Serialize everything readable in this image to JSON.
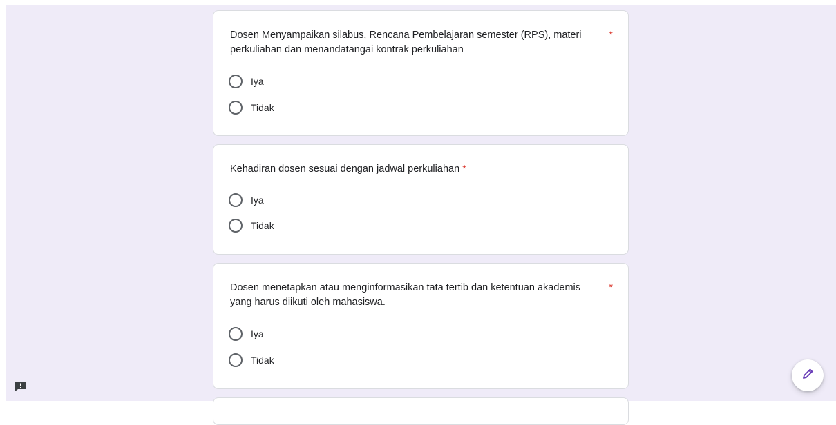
{
  "questions": [
    {
      "title": "Dosen Menyampaikan silabus, Rencana Pembelajaran semester (RPS), materi perkuliahan dan menandatangai kontrak perkuliahan",
      "required_mark": "*",
      "options": [
        "Iya",
        "Tidak"
      ]
    },
    {
      "title": "Kehadiran dosen sesuai dengan jadwal perkuliahan",
      "required_mark": "*",
      "options": [
        "Iya",
        "Tidak"
      ]
    },
    {
      "title": "Dosen menetapkan atau menginformasikan tata tertib dan ketentuan akademis yang harus diikuti oleh mahasiswa.",
      "required_mark": "*",
      "options": [
        "Iya",
        "Tidak"
      ]
    }
  ],
  "icons": {
    "feedback": "feedback-icon",
    "edit": "pencil-icon"
  },
  "colors": {
    "background": "#efebf8",
    "required": "#d93025",
    "accent": "#673ab7"
  }
}
